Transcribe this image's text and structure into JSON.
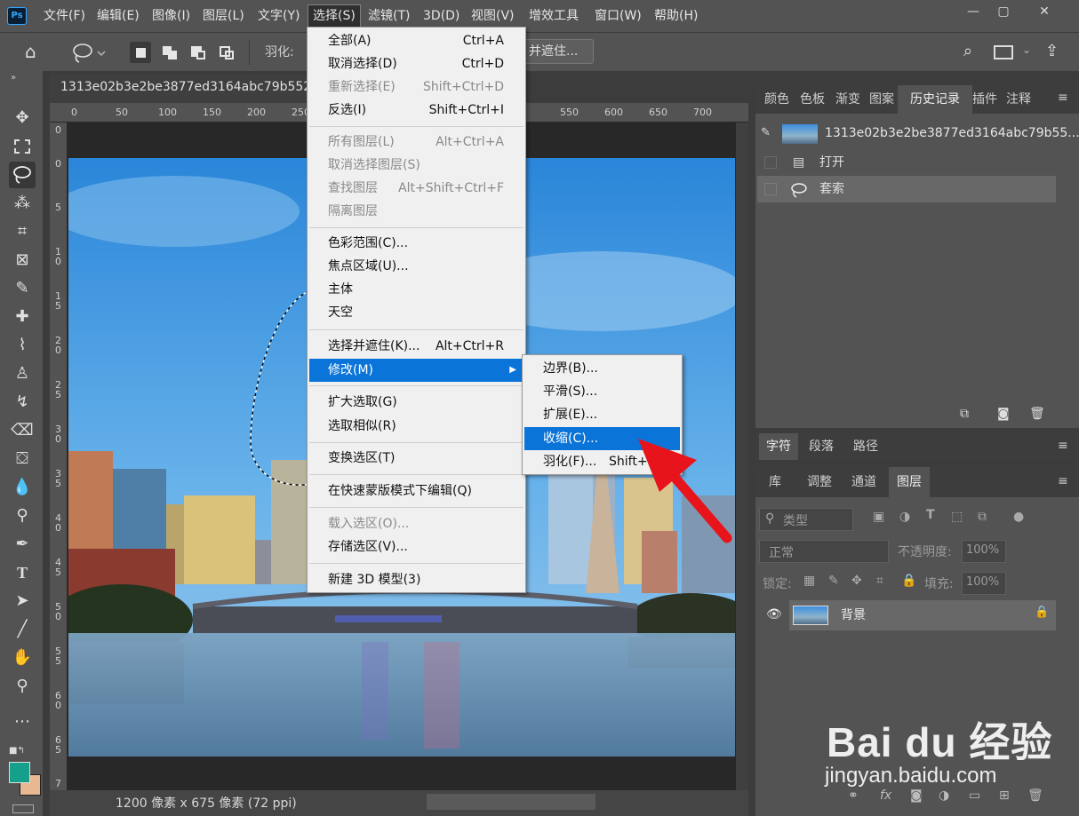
{
  "app": {
    "logo": "Ps"
  },
  "menubar": [
    "文件(F)",
    "编辑(E)",
    "图像(I)",
    "图层(L)",
    "文字(Y)",
    "选择(S)",
    "滤镜(T)",
    "3D(D)",
    "视图(V)",
    "增效工具",
    "窗口(W)",
    "帮助(H)"
  ],
  "options": {
    "feather_label": "羽化:",
    "select_mask_label": "并遮住..."
  },
  "document": {
    "tab_title": "1313e02b3e2be3877ed3164abc79b552.jp",
    "status": "1200 像素 x 675 像素 (72 ppi)",
    "ruler_top": [
      "0",
      "50",
      "100",
      "150",
      "200",
      "250",
      "550",
      "600",
      "650",
      "700"
    ],
    "ruler_left": [
      "0",
      "0",
      "5",
      "1 0",
      "1 5",
      "2 0",
      "2 5",
      "3 0",
      "3 5",
      "4 0",
      "4 5",
      "5 0",
      "5 5",
      "6 0",
      "6 5",
      "7"
    ]
  },
  "select_menu": {
    "items": [
      {
        "label": "全部(A)",
        "shortcut": "Ctrl+A",
        "state": "normal"
      },
      {
        "label": "取消选择(D)",
        "shortcut": "Ctrl+D",
        "state": "normal"
      },
      {
        "label": "重新选择(E)",
        "shortcut": "Shift+Ctrl+D",
        "state": "disabled"
      },
      {
        "label": "反选(I)",
        "shortcut": "Shift+Ctrl+I",
        "state": "normal"
      },
      {
        "label": "所有图层(L)",
        "shortcut": "Alt+Ctrl+A",
        "state": "disabled"
      },
      {
        "label": "取消选择图层(S)",
        "shortcut": "",
        "state": "disabled"
      },
      {
        "label": "查找图层",
        "shortcut": "Alt+Shift+Ctrl+F",
        "state": "disabled"
      },
      {
        "label": "隔离图层",
        "shortcut": "",
        "state": "disabled"
      },
      {
        "label": "色彩范围(C)...",
        "shortcut": "",
        "state": "normal"
      },
      {
        "label": "焦点区域(U)...",
        "shortcut": "",
        "state": "normal"
      },
      {
        "label": "主体",
        "shortcut": "",
        "state": "normal"
      },
      {
        "label": "天空",
        "shortcut": "",
        "state": "normal"
      },
      {
        "label": "选择并遮住(K)...",
        "shortcut": "Alt+Ctrl+R",
        "state": "normal"
      },
      {
        "label": "修改(M)",
        "shortcut": "",
        "state": "highlighted"
      },
      {
        "label": "扩大选取(G)",
        "shortcut": "",
        "state": "normal"
      },
      {
        "label": "选取相似(R)",
        "shortcut": "",
        "state": "normal"
      },
      {
        "label": "变换选区(T)",
        "shortcut": "",
        "state": "normal"
      },
      {
        "label": "在快速蒙版模式下编辑(Q)",
        "shortcut": "",
        "state": "normal"
      },
      {
        "label": "载入选区(O)...",
        "shortcut": "",
        "state": "disabled"
      },
      {
        "label": "存储选区(V)...",
        "shortcut": "",
        "state": "normal"
      },
      {
        "label": "新建 3D 模型(3)",
        "shortcut": "",
        "state": "normal"
      }
    ]
  },
  "modify_submenu": {
    "items": [
      {
        "label": "边界(B)...",
        "shortcut": "",
        "state": "normal"
      },
      {
        "label": "平滑(S)...",
        "shortcut": "",
        "state": "normal"
      },
      {
        "label": "扩展(E)...",
        "shortcut": "",
        "state": "normal"
      },
      {
        "label": "收缩(C)...",
        "shortcut": "",
        "state": "highlighted"
      },
      {
        "label": "羽化(F)...",
        "shortcut": "Shift+",
        "state": "normal"
      }
    ]
  },
  "panel1": {
    "tabs": [
      "颜色",
      "色板",
      "渐变",
      "图案",
      "历史记录",
      "插件",
      "注释"
    ],
    "active_tab": "历史记录",
    "history_snapshot": "1313e02b3e2be3877ed3164abc79b55...",
    "history": [
      "打开",
      "套索"
    ]
  },
  "panel2": {
    "tabs": [
      "字符",
      "段落",
      "路径"
    ],
    "active_tab": "字符"
  },
  "panel3": {
    "tabs": [
      "库",
      "调整",
      "通道",
      "图层"
    ],
    "active_tab": "图层",
    "filter_kind": "类型",
    "blend_mode": "正常",
    "opacity_label": "不透明度:",
    "opacity_value": "100%",
    "lock_label": "锁定:",
    "fill_label": "填充:",
    "fill_value": "100%",
    "layer_name": "背景",
    "footer_icons": [
      "link-icon",
      "fx-icon",
      "mask-icon",
      "adjustment-icon",
      "folder-icon",
      "new-layer-icon",
      "trash-icon"
    ]
  },
  "watermark": {
    "brand": "Bai du 经验",
    "url": "jingyan.baidu.com"
  },
  "colors": {
    "highlight": "#0a74d8",
    "foreground_swatch": "#14a08a",
    "background_swatch": "#e8b892",
    "arrow": "#e8141c"
  }
}
